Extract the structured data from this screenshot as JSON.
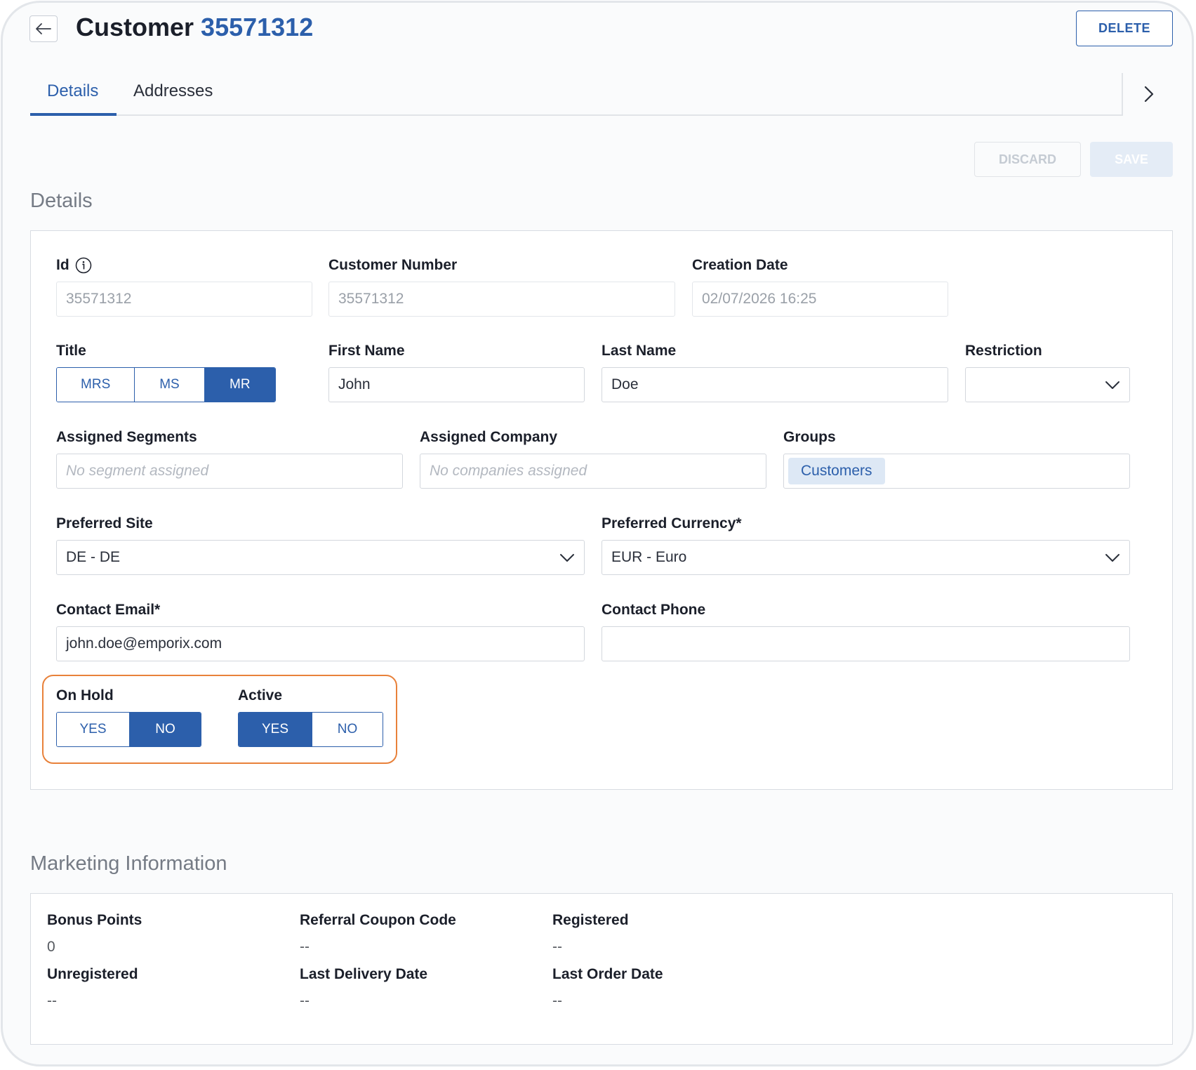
{
  "header": {
    "title_prefix": "Customer",
    "title_number": "35571312",
    "delete_label": "DELETE"
  },
  "tabs": [
    {
      "label": "Details",
      "active": true
    },
    {
      "label": "Addresses",
      "active": false
    }
  ],
  "actions": {
    "discard_label": "DISCARD",
    "save_label": "SAVE"
  },
  "details": {
    "section_title": "Details",
    "id": {
      "label": "Id",
      "value": "35571312"
    },
    "customer_number": {
      "label": "Customer Number",
      "value": "35571312"
    },
    "creation_date": {
      "label": "Creation Date",
      "value": "02/07/2026 16:25"
    },
    "title": {
      "label": "Title",
      "options": [
        "MRS",
        "MS",
        "MR"
      ],
      "selected": "MR"
    },
    "first_name": {
      "label": "First Name",
      "value": "John"
    },
    "last_name": {
      "label": "Last Name",
      "value": "Doe"
    },
    "restriction": {
      "label": "Restriction",
      "value": ""
    },
    "assigned_segments": {
      "label": "Assigned Segments",
      "placeholder": "No segment assigned"
    },
    "assigned_company": {
      "label": "Assigned Company",
      "placeholder": "No companies assigned"
    },
    "groups": {
      "label": "Groups",
      "chips": [
        "Customers"
      ]
    },
    "preferred_site": {
      "label": "Preferred Site",
      "value": "DE - DE"
    },
    "preferred_currency": {
      "label": "Preferred Currency*",
      "value": "EUR - Euro"
    },
    "contact_email": {
      "label": "Contact Email*",
      "value": "john.doe@emporix.com"
    },
    "contact_phone": {
      "label": "Contact Phone",
      "value": ""
    },
    "on_hold": {
      "label": "On Hold",
      "options": [
        "YES",
        "NO"
      ],
      "selected": "NO"
    },
    "active": {
      "label": "Active",
      "options": [
        "YES",
        "NO"
      ],
      "selected": "YES"
    }
  },
  "marketing": {
    "section_title": "Marketing Information",
    "fields": [
      {
        "label": "Bonus Points",
        "value": "0"
      },
      {
        "label": "Referral Coupon Code",
        "value": "--"
      },
      {
        "label": "Registered",
        "value": "--"
      },
      {
        "label": "Unregistered",
        "value": "--"
      },
      {
        "label": "Last Delivery Date",
        "value": "--"
      },
      {
        "label": "Last Order Date",
        "value": "--"
      }
    ]
  },
  "colors": {
    "accent": "#2c5fab",
    "highlight": "#e8813a"
  },
  "icons": [
    "arrow-left-icon",
    "chevron-right-icon",
    "info-icon",
    "chevron-down-icon"
  ]
}
